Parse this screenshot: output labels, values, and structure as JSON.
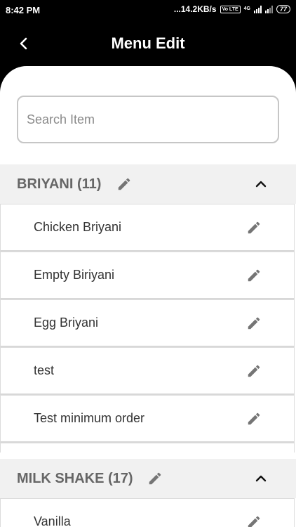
{
  "status": {
    "time": "8:42 PM",
    "net": "...14.2KB/s",
    "volte": "Vo LTE",
    "net_type": "4G",
    "battery": "77"
  },
  "appbar": {
    "title": "Menu Edit",
    "back_icon": "back-chevron-icon"
  },
  "search": {
    "placeholder": "Search Item",
    "value": ""
  },
  "categories": [
    {
      "name": "BRIYANI (11)",
      "expanded": true,
      "items": [
        {
          "name": "Chicken Briyani"
        },
        {
          "name": "Empty Biriyani"
        },
        {
          "name": "Egg Briyani"
        },
        {
          "name": "test"
        },
        {
          "name": "Test minimum order"
        }
      ]
    },
    {
      "name": "MILK SHAKE (17)",
      "expanded": true,
      "items": [
        {
          "name": "Vanilla"
        }
      ]
    }
  ],
  "colors": {
    "appbar": "#000000",
    "header_bg": "#f1f1f1",
    "icon": "#757575",
    "text": "#333333"
  }
}
